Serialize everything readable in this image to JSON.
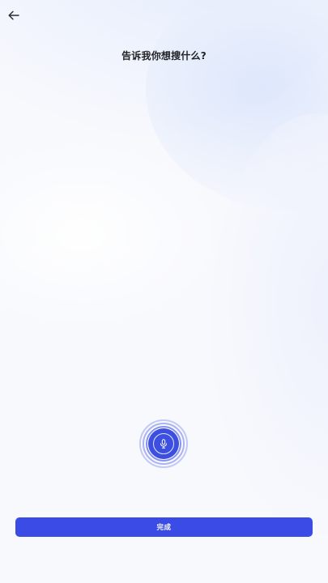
{
  "header": {
    "back_icon": "arrow-left-icon",
    "title": "告诉我你想搜什么?"
  },
  "voice": {
    "mic_icon": "microphone-icon",
    "accent_color": "#3d4fe0"
  },
  "footer": {
    "done_label": "完成",
    "button_color": "#3b4ce6"
  }
}
